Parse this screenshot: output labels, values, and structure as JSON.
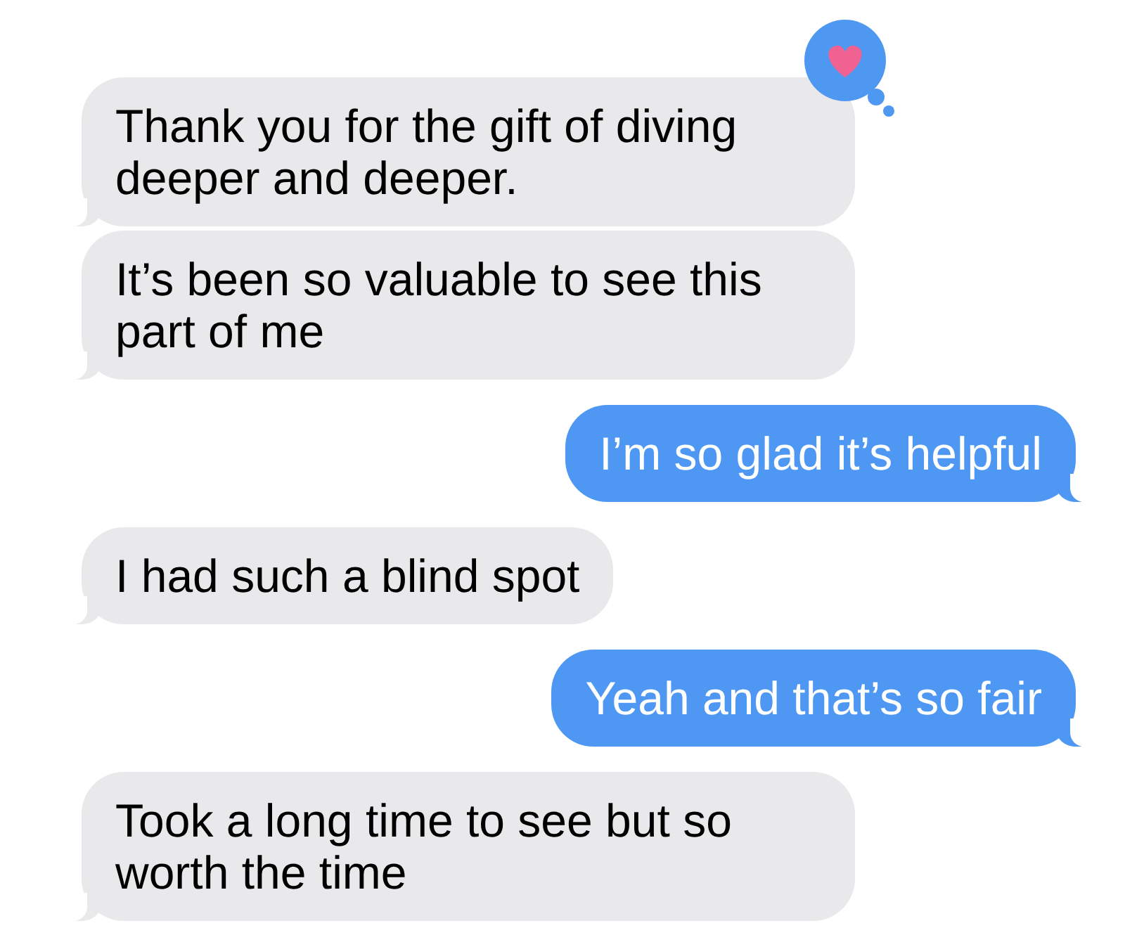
{
  "messages": [
    {
      "kind": "received",
      "text": "Thank you for the gift of diving deeper and deeper.",
      "hearted": true
    },
    {
      "kind": "received",
      "text": "It’s been so valuable to see this part of me",
      "hearted": false
    },
    {
      "kind": "sent",
      "text": "I’m so glad it’s helpful",
      "hearted": false
    },
    {
      "kind": "received",
      "text": "I had such a blind spot",
      "hearted": false
    },
    {
      "kind": "sent",
      "text": "Yeah and that’s so fair",
      "hearted": false
    },
    {
      "kind": "received",
      "text": "Took a long time to see but so worth the time",
      "hearted": false
    }
  ]
}
